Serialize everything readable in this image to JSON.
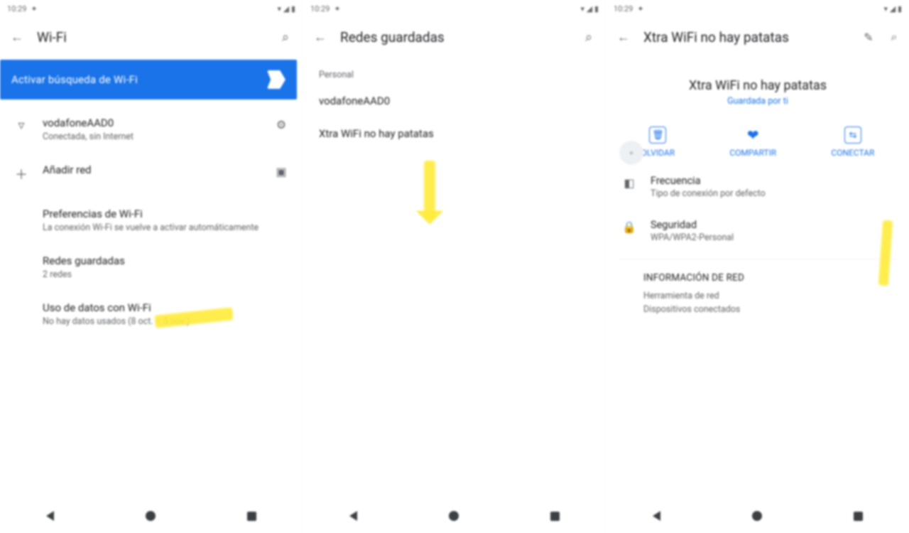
{
  "statusbar": {
    "time": "10:29",
    "signal_icons": "▾ ◢ ▮"
  },
  "screen1": {
    "title": "Wi-Fi",
    "banner": "Activar búsqueda de Wi-Fi",
    "network": {
      "ssid": "vodafoneAAD0",
      "status": "Conectada, sin Internet"
    },
    "add_network": "Añadir red",
    "prefs": {
      "title": "Preferencias de Wi-Fi",
      "sub": "La conexión Wi-Fi se vuelve a activar automáticamente"
    },
    "saved": {
      "title": "Redes guardadas",
      "sub": "2 redes"
    },
    "usage": {
      "title": "Uso de datos con Wi-Fi",
      "sub": "No hay datos usados (8 oct. – 5 nov.)"
    }
  },
  "screen2": {
    "title": "Redes guardadas",
    "label": "Personal",
    "items": [
      "vodafoneAAD0",
      "Xtra WiFi no hay patatas"
    ]
  },
  "screen3": {
    "title": "Xtra WiFi no hay patatas",
    "header": {
      "big": "Xtra WiFi no hay patatas",
      "sub": "Guardada por ti"
    },
    "actions": {
      "delete": "OLVIDAR",
      "share": "COMPARTIR",
      "connect": "CONECTAR"
    },
    "rows": {
      "freq": {
        "k": "Frecuencia",
        "v": "Tipo de conexión por defecto"
      },
      "sec": {
        "k": "Seguridad",
        "v": "WPA/WPA2-Personal"
      }
    },
    "netinfo": {
      "hdr": "INFORMACIÓN DE RED",
      "lines": [
        "Herramienta de red",
        "Dispositivos conectados"
      ]
    }
  },
  "nav": {
    "back": "back",
    "home": "home",
    "recent": "recent"
  }
}
